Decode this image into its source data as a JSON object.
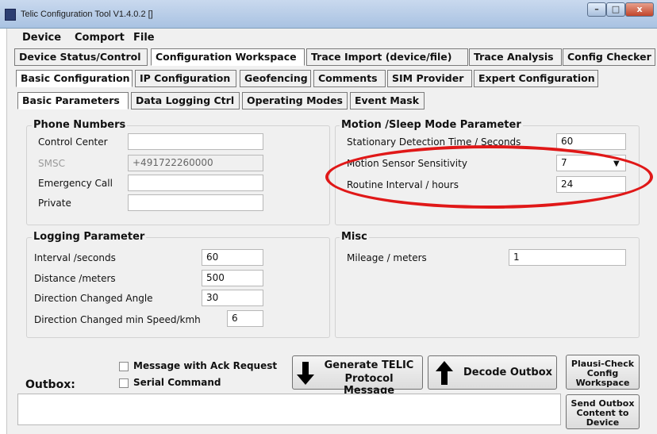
{
  "window": {
    "title": "Telic Configuration Tool V1.4.0.2 []",
    "min": "–",
    "max": "□",
    "close": "x"
  },
  "menu": [
    "Device",
    "Comport",
    "File"
  ],
  "main_tabs": [
    "Device Status/Control",
    "Configuration Workspace",
    "Trace Import (device/file)",
    "Trace Analysis",
    "Config Checker"
  ],
  "sub_tabs": [
    "Basic Configuration",
    "IP Configuration",
    "Geofencing",
    "Comments",
    "SIM Provider",
    "Expert Configuration"
  ],
  "inner_tabs": [
    "Basic Parameters",
    "Data Logging Ctrl",
    "Operating Modes",
    "Event Mask"
  ],
  "phone": {
    "title": "Phone Numbers",
    "control_center": {
      "label": "Control Center",
      "value": ""
    },
    "smsc": {
      "label": "SMSC",
      "value": "+491722260000"
    },
    "emergency": {
      "label": "Emergency Call",
      "value": ""
    },
    "private": {
      "label": "Private",
      "value": ""
    }
  },
  "motion": {
    "title": "Motion /Sleep Mode Parameter",
    "stationary": {
      "label": "Stationary Detection Time / Seconds",
      "value": "60"
    },
    "sensitivity": {
      "label": "Motion Sensor Sensitivity",
      "value": "7"
    },
    "routine": {
      "label": "Routine Interval / hours",
      "value": "24"
    }
  },
  "logging": {
    "title": "Logging Parameter",
    "interval": {
      "label": "Interval /seconds",
      "value": "60"
    },
    "distance": {
      "label": "Distance /meters",
      "value": "500"
    },
    "direction": {
      "label": "Direction Changed Angle",
      "value": "30"
    },
    "min_speed": {
      "label": "Direction Changed min Speed/kmh",
      "value": "6"
    }
  },
  "misc": {
    "title": "Misc",
    "mileage": {
      "label": "Mileage / meters",
      "value": "1"
    }
  },
  "outbox": {
    "label": "Outbox:",
    "ack_label": "Message with Ack Request",
    "serial_label": "Serial Command",
    "generate_line1": "Generate TELIC",
    "generate_line2": "Protocol Message",
    "decode": "Decode Outbox",
    "plausi_line1": "Plausi-Check",
    "plausi_line2": "Config",
    "plausi_line3": "Workspace",
    "send_line1": "Send Outbox",
    "send_line2": "Content to",
    "send_line3": "Device",
    "content": ""
  },
  "colors": {
    "highlight_ellipse": "#e01818"
  }
}
